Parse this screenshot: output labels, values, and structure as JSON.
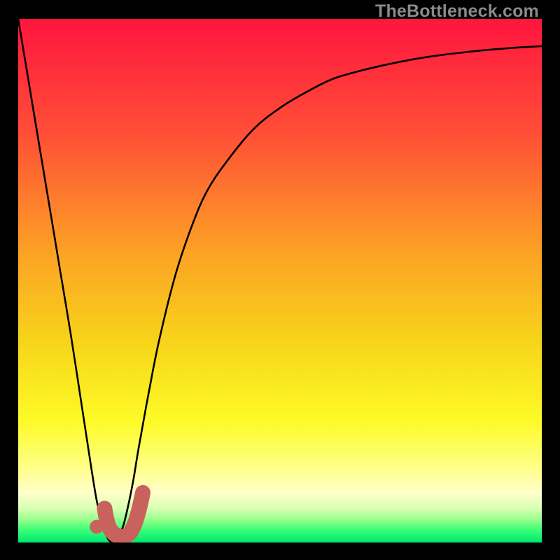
{
  "watermark": {
    "text": "TheBottleneck.com"
  },
  "chart_data": {
    "type": "line",
    "title": "",
    "xlabel": "",
    "ylabel": "",
    "xlim": [
      0,
      100
    ],
    "ylim": [
      0,
      100
    ],
    "grid": false,
    "legend": false,
    "background_gradient": {
      "stops": [
        {
          "offset": 0.0,
          "color": "#ff153f"
        },
        {
          "offset": 0.22,
          "color": "#ff4f36"
        },
        {
          "offset": 0.45,
          "color": "#fca324"
        },
        {
          "offset": 0.62,
          "color": "#f7d51a"
        },
        {
          "offset": 0.77,
          "color": "#fdfb27"
        },
        {
          "offset": 0.85,
          "color": "#ffff80"
        },
        {
          "offset": 0.905,
          "color": "#ffffc9"
        },
        {
          "offset": 0.935,
          "color": "#d9ffb3"
        },
        {
          "offset": 0.955,
          "color": "#9dff8f"
        },
        {
          "offset": 0.975,
          "color": "#3dff78"
        },
        {
          "offset": 1.0,
          "color": "#00e770"
        }
      ]
    },
    "series": [
      {
        "name": "bottleneck-curve",
        "color": "#000000",
        "x": [
          0,
          2,
          4,
          6,
          8,
          10,
          12,
          14,
          15,
          16,
          17,
          18,
          19,
          20,
          21,
          22,
          23,
          25,
          27,
          30,
          33,
          36,
          40,
          45,
          50,
          55,
          60,
          65,
          70,
          75,
          80,
          85,
          90,
          95,
          100
        ],
        "y": [
          100,
          88,
          76,
          64,
          52,
          40,
          27,
          14,
          8,
          4,
          1,
          0,
          1,
          3,
          7,
          12,
          18,
          29,
          39,
          51,
          60,
          67,
          73,
          79,
          83,
          86,
          88.5,
          90,
          91.2,
          92.2,
          93,
          93.6,
          94.1,
          94.5,
          94.8
        ]
      }
    ],
    "marker": {
      "name": "j-marker",
      "color": "#c9615d",
      "dot": {
        "x": 15.0,
        "y": 3.0
      },
      "stroke": [
        {
          "x": 16.5,
          "y": 6.5
        },
        {
          "x": 17.0,
          "y": 4.0
        },
        {
          "x": 17.8,
          "y": 2.2
        },
        {
          "x": 19.2,
          "y": 1.2
        },
        {
          "x": 20.8,
          "y": 1.4
        },
        {
          "x": 22.0,
          "y": 3.0
        },
        {
          "x": 23.0,
          "y": 6.0
        },
        {
          "x": 23.8,
          "y": 9.5
        }
      ]
    }
  }
}
